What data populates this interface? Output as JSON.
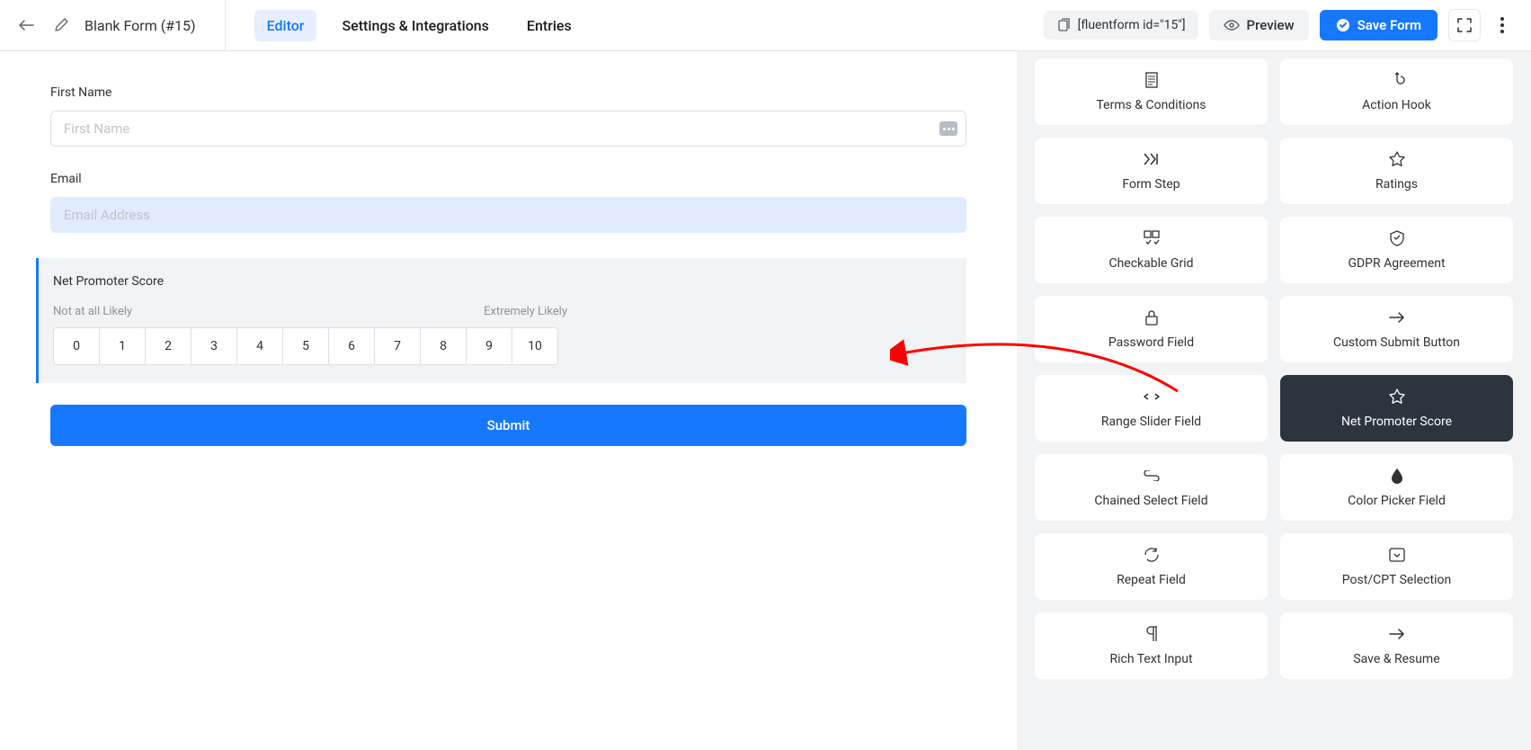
{
  "header": {
    "form_title": "Blank Form (#15)",
    "tabs": {
      "editor": "Editor",
      "settings": "Settings & Integrations",
      "entries": "Entries"
    },
    "shortcode": "[fluentform id=\"15\"]",
    "preview_label": "Preview",
    "save_label": "Save Form"
  },
  "canvas": {
    "first_name": {
      "label": "First Name",
      "placeholder": "First Name"
    },
    "email": {
      "label": "Email",
      "placeholder": "Email Address"
    },
    "nps": {
      "title": "Net Promoter Score",
      "left_label": "Not at all Likely",
      "right_label": "Extremely Likely",
      "scale": [
        "0",
        "1",
        "2",
        "3",
        "4",
        "5",
        "6",
        "7",
        "8",
        "9",
        "10"
      ]
    },
    "submit_label": "Submit"
  },
  "sidebar_fields": [
    {
      "id": "terms",
      "label": "Terms & Conditions",
      "icon": "document-icon"
    },
    {
      "id": "action-hook",
      "label": "Action Hook",
      "icon": "hook-icon"
    },
    {
      "id": "form-step",
      "label": "Form Step",
      "icon": "step-icon"
    },
    {
      "id": "ratings",
      "label": "Ratings",
      "icon": "star-icon"
    },
    {
      "id": "checkable-grid",
      "label": "Checkable Grid",
      "icon": "grid-icon"
    },
    {
      "id": "gdpr",
      "label": "GDPR Agreement",
      "icon": "shield-icon"
    },
    {
      "id": "password",
      "label": "Password Field",
      "icon": "lock-icon"
    },
    {
      "id": "custom-submit",
      "label": "Custom Submit Button",
      "icon": "arrow-icon"
    },
    {
      "id": "range-slider",
      "label": "Range Slider Field",
      "icon": "slider-icon"
    },
    {
      "id": "nps",
      "label": "Net Promoter Score",
      "icon": "star-icon",
      "selected": true
    },
    {
      "id": "chained-select",
      "label": "Chained Select Field",
      "icon": "chain-icon"
    },
    {
      "id": "color-picker",
      "label": "Color Picker Field",
      "icon": "drop-icon"
    },
    {
      "id": "repeat",
      "label": "Repeat Field",
      "icon": "repeat-icon"
    },
    {
      "id": "post-cpt",
      "label": "Post/CPT Selection",
      "icon": "select-icon"
    },
    {
      "id": "rich-text",
      "label": "Rich Text Input",
      "icon": "pilcrow-icon"
    },
    {
      "id": "save-resume",
      "label": "Save & Resume",
      "icon": "arrow-icon"
    }
  ]
}
